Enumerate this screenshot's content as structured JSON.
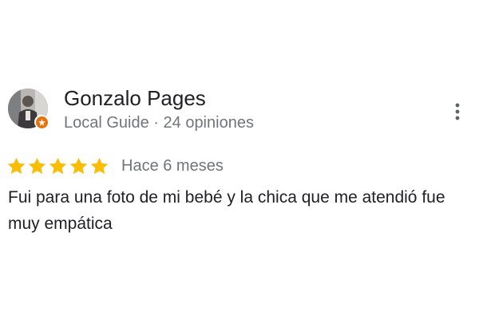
{
  "review": {
    "author_name": "Gonzalo Pages",
    "author_meta": "Local Guide · 24 opiniones",
    "rating": 5,
    "rating_max": 5,
    "date": "Hace 6 meses",
    "text": "Fui para una foto de mi bebé y la chica que me atendió fue muy empática"
  },
  "icons": {
    "avatar": "user-avatar-photo",
    "badge": "local-guide-badge-icon",
    "more": "more-vert-icon",
    "star": "star-filled-icon"
  },
  "colors": {
    "star": "#fbbc04",
    "badge": "#e8710a",
    "text_primary": "#202124",
    "text_secondary": "#70757a"
  }
}
